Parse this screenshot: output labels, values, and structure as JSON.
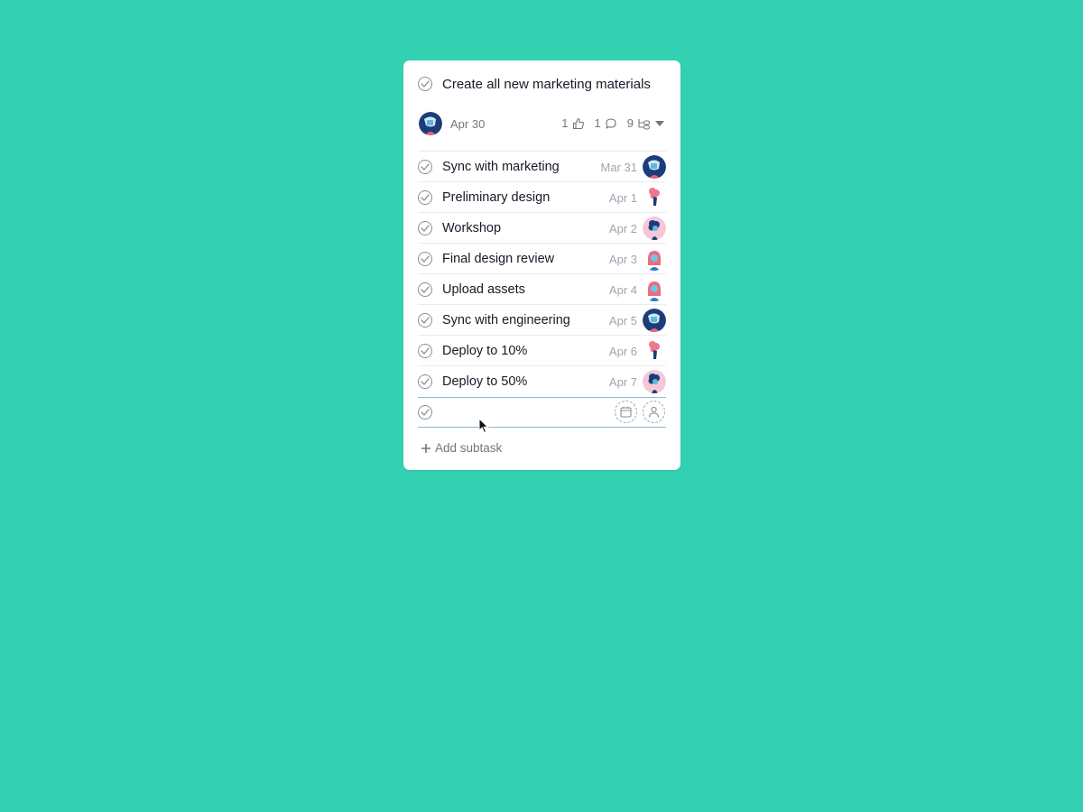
{
  "task": {
    "title": "Create all new marketing materials",
    "due_date": "Apr 30",
    "likes": "1",
    "comments": "1",
    "subtask_count": "9"
  },
  "subtasks": [
    {
      "label": "Sync with marketing",
      "date": "Mar 31",
      "avatar": "avatar-blue"
    },
    {
      "label": "Preliminary design",
      "date": "Apr 1",
      "avatar": "avatar-pink-tall"
    },
    {
      "label": "Workshop",
      "date": "Apr 2",
      "avatar": "avatar-curly"
    },
    {
      "label": "Final design review",
      "date": "Apr 3",
      "avatar": "avatar-redhead"
    },
    {
      "label": "Upload assets",
      "date": "Apr 4",
      "avatar": "avatar-redhead"
    },
    {
      "label": "Sync with engineering",
      "date": "Apr 5",
      "avatar": "avatar-blue"
    },
    {
      "label": "Deploy to 10%",
      "date": "Apr 6",
      "avatar": "avatar-pink-tall"
    },
    {
      "label": "Deploy to 50%",
      "date": "Apr 7",
      "avatar": "avatar-curly"
    }
  ],
  "add_subtask_label": "Add subtask",
  "icons": {
    "like": "thumbs-up-icon",
    "comment": "comment-icon",
    "subtasks": "subtask-icon",
    "calendar": "calendar-icon",
    "assignee": "person-icon"
  },
  "colors": {
    "background": "#33d0b1",
    "card": "#ffffff",
    "text": "#151b26",
    "muted": "#6f7782",
    "focus_border": "#8fb8cf"
  }
}
